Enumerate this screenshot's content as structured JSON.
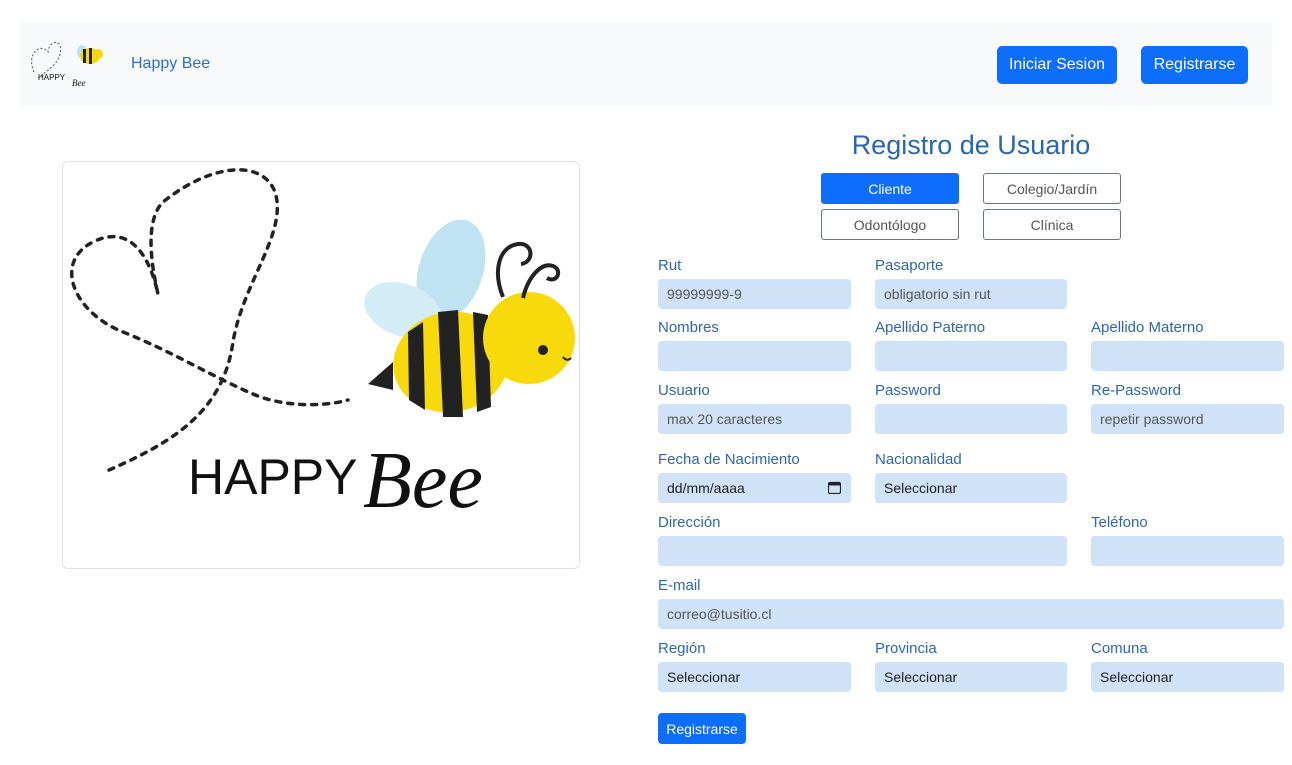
{
  "navbar": {
    "brand": "Happy Bee",
    "login_label": "Iniciar Sesion",
    "register_label": "Registrarse"
  },
  "logo": {
    "word1": "HAPPY",
    "word2": "Bee"
  },
  "form": {
    "title": "Registro de Usuario",
    "user_types": [
      "Cliente",
      "Colegio/Jardín",
      "Odontólogo",
      "Clínica"
    ],
    "active_type": "Cliente",
    "rut": {
      "label": "Rut",
      "placeholder": "99999999-9"
    },
    "pasaporte": {
      "label": "Pasaporte",
      "placeholder": "obligatorio sin rut"
    },
    "nombres": {
      "label": "Nombres",
      "placeholder": ""
    },
    "apellido_paterno": {
      "label": "Apellido Paterno",
      "placeholder": ""
    },
    "apellido_materno": {
      "label": "Apellido Materno",
      "placeholder": ""
    },
    "usuario": {
      "label": "Usuario",
      "placeholder": "max 20 caracteres"
    },
    "password": {
      "label": "Password",
      "placeholder": ""
    },
    "repassword": {
      "label": "Re-Password",
      "placeholder": "repetir password"
    },
    "fecha": {
      "label": "Fecha de Nacimiento",
      "value": "dd/mm/aaaa"
    },
    "nacionalidad": {
      "label": "Nacionalidad",
      "value": "Seleccionar"
    },
    "direccion": {
      "label": "Dirección",
      "placeholder": ""
    },
    "telefono": {
      "label": "Teléfono",
      "placeholder": ""
    },
    "email": {
      "label": "E-mail",
      "placeholder": "correo@tusitio.cl"
    },
    "region": {
      "label": "Región",
      "value": "Seleccionar"
    },
    "provincia": {
      "label": "Provincia",
      "value": "Seleccionar"
    },
    "comuna": {
      "label": "Comuna",
      "value": "Seleccionar"
    },
    "submit_label": "Registrarse"
  },
  "colors": {
    "primary": "#0d6efd",
    "label": "#2f67a8",
    "input_bg": "#cfe2f7",
    "bee_yellow": "#f7d90c",
    "bee_wing": "#bfe3f2"
  },
  "icons": {
    "logo": "happy-bee-logo",
    "date": "calendar-icon"
  }
}
